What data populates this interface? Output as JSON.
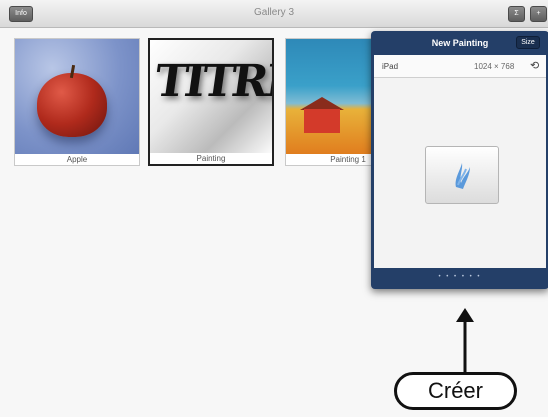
{
  "header": {
    "left_button": "Info",
    "title": "Gallery 3",
    "right_button_1": "Σ",
    "right_button_2": "+"
  },
  "gallery": {
    "items": [
      {
        "label": "Apple"
      },
      {
        "label": "Painting",
        "image_text": "TITRE"
      },
      {
        "label": "Painting 1"
      }
    ]
  },
  "popover": {
    "title": "New Painting",
    "button": "Size",
    "device": "iPad",
    "resolution": "1024 × 768",
    "rotate_icon": "rotate-icon",
    "create_icon": "brush-stroke-icon",
    "page_dots": "• • • • • •"
  },
  "annotation": {
    "label": "Créer"
  },
  "colors": {
    "popover_bg": "#243f68",
    "brush": "#4a90d9"
  }
}
